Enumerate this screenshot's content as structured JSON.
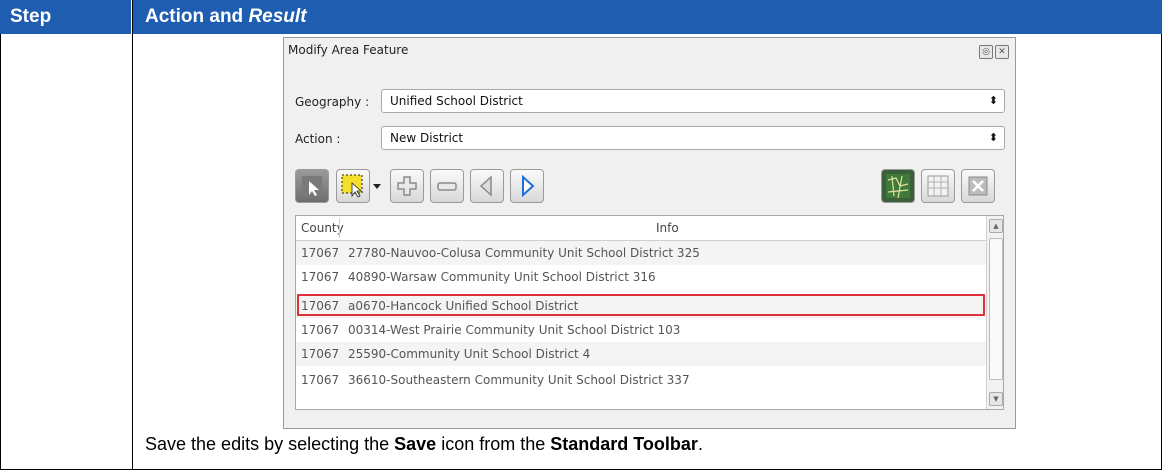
{
  "header": {
    "step_label": "Step",
    "action_label": "Action and ",
    "result_label": "Result"
  },
  "dialog": {
    "title": "Modify Area Feature",
    "geography_label": "Geography :",
    "geography_value": "Unified School District",
    "action_label": "Action :",
    "action_value": "New District",
    "toolbar_icons": [
      "select-feature-icon",
      "select-rectangle-icon",
      "dropdown-arrow-icon",
      "add-icon",
      "remove-icon",
      "previous-icon",
      "next-icon",
      "map-icon",
      "table-icon",
      "clear-icon"
    ],
    "columns": [
      "County",
      "Info"
    ],
    "rows": [
      [
        "17067",
        "27780-Nauvoo-Colusa Community Unit School District 325"
      ],
      [
        "17067",
        "40890-Warsaw Community Unit School District 316"
      ],
      [
        "17067",
        "a0670-Hancock Unified School District"
      ],
      [
        "17067",
        "00314-West Prairie Community Unit School District 103"
      ],
      [
        "17067",
        "25590-Community Unit School District 4"
      ],
      [
        "17067",
        "36610-Southeastern Community Unit School District 337"
      ]
    ],
    "highlighted_row": 2
  },
  "caption": {
    "t1": "Save the edits by selecting the ",
    "b1": "Save",
    "t2": " icon from the ",
    "b2": "Standard Toolbar",
    "t3": "."
  },
  "colors": {
    "header_bg": "#1f5db0",
    "highlight": "#e0303a",
    "next_blue": "#1e6fd9"
  }
}
